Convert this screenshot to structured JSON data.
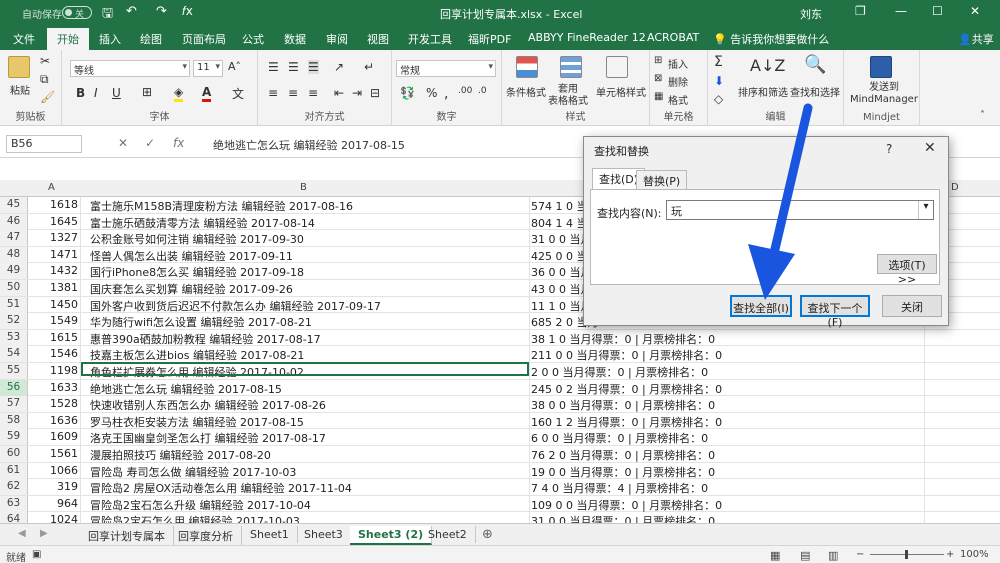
{
  "window": {
    "autosave_label": "自动保存",
    "autosave_state": "关",
    "title": "回享计划专属本.xlsx  -  Excel",
    "user": "刘东",
    "restore_glyph": "❐",
    "minimize_glyph": "—",
    "maximize_glyph": "☐",
    "close_glyph": "✕"
  },
  "qat": {
    "save": "🖫",
    "undo": "↶",
    "redo": "↷",
    "fx": "𝑓x"
  },
  "tabs": [
    "文件",
    "开始",
    "插入",
    "绘图",
    "页面布局",
    "公式",
    "数据",
    "审阅",
    "视图",
    "开发工具",
    "福昕PDF",
    "ABBYY FineReader 12",
    "ACROBAT"
  ],
  "active_tab": "开始",
  "tellme": "告诉我你想要做什么",
  "share": "共享",
  "ribbon": {
    "clipboard": {
      "paste": "粘贴",
      "label": "剪贴板"
    },
    "font": {
      "name": "等线",
      "size": "11",
      "label": "字体",
      "bold": "B",
      "italic": "I",
      "underline": "U"
    },
    "alignment": {
      "label": "对齐方式"
    },
    "number": {
      "format": "常规",
      "label": "数字"
    },
    "styles": {
      "cond": "条件格式",
      "table": "套用\n表格格式",
      "cell": "单元格样式",
      "label": "样式"
    },
    "cells": {
      "insert": "插入",
      "delete": "删除",
      "format": "格式",
      "label": "单元格"
    },
    "editing": {
      "sort": "排序和筛选",
      "find": "查找和选择",
      "label": "编辑"
    },
    "mindjet": {
      "send": "发送到\nMindManager",
      "label": "Mindjet"
    }
  },
  "formula_bar": {
    "name_box": "B56",
    "cancel": "✕",
    "enter": "✓",
    "fx": "fx",
    "content": "绝地逃亡怎么玩 编辑经验 2017-08-15"
  },
  "columns": [
    "A",
    "B",
    "D"
  ],
  "rows": [
    {
      "n": "45",
      "a": "1618",
      "b": "富士施乐M158B清理废粉方法 编辑经验 2017-08-16",
      "c": "574 1 0 当月"
    },
    {
      "n": "46",
      "a": "1645",
      "b": "富士施乐硒鼓清零方法 编辑经验 2017-08-14",
      "c": "804 1 4 当月"
    },
    {
      "n": "47",
      "a": "1327",
      "b": "公积金账号如何注销 编辑经验 2017-09-30",
      "c": "31 0 0 当月"
    },
    {
      "n": "48",
      "a": "1471",
      "b": "怪兽人偶怎么出装 编辑经验 2017-09-11",
      "c": "425 0 0 当月"
    },
    {
      "n": "49",
      "a": "1432",
      "b": "国行iPhone8怎么买 编辑经验 2017-09-18",
      "c": "36 0 0 当月"
    },
    {
      "n": "50",
      "a": "1381",
      "b": "国庆套怎么买划算 编辑经验 2017-09-26",
      "c": "43 0 0 当月"
    },
    {
      "n": "51",
      "a": "1450",
      "b": "国外客户收到货后迟迟不付款怎么办 编辑经验 2017-09-17",
      "c": "11 1 0 当月"
    },
    {
      "n": "52",
      "a": "1549",
      "b": "华为随行wifi怎么设置 编辑经验 2017-08-21",
      "c": "685 2 0 当月"
    },
    {
      "n": "53",
      "a": "1615",
      "b": "惠普390a硒鼓加粉教程 编辑经验 2017-08-17",
      "c": "38 1 0 当月得票：0 | 月票榜排名：0"
    },
    {
      "n": "54",
      "a": "1546",
      "b": "技嘉主板怎么进bios 编辑经验 2017-08-21",
      "c": "211 0 0 当月得票：0 | 月票榜排名：0"
    },
    {
      "n": "55",
      "a": "1198",
      "b": "角色栏扩展券怎么用 编辑经验 2017-10-02",
      "c": "2 0 0 当月得票：0 | 月票榜排名：0"
    },
    {
      "n": "56",
      "a": "1633",
      "b": "绝地逃亡怎么玩 编辑经验 2017-08-15",
      "c": "245 0 2 当月得票：0 | 月票榜排名：0"
    },
    {
      "n": "57",
      "a": "1528",
      "b": "快速收错别人东西怎么办 编辑经验 2017-08-26",
      "c": "38 0 0 当月得票：0 | 月票榜排名：0"
    },
    {
      "n": "58",
      "a": "1636",
      "b": "罗马柱衣柜安装方法 编辑经验 2017-08-15",
      "c": "160 1 2 当月得票：0 | 月票榜排名：0"
    },
    {
      "n": "59",
      "a": "1609",
      "b": "洛克王国幽皇剑圣怎么打 编辑经验 2017-08-17",
      "c": "6 0 0 当月得票：0 | 月票榜排名：0"
    },
    {
      "n": "60",
      "a": "1561",
      "b": "漫展拍照技巧 编辑经验 2017-08-20",
      "c": "76 2 0 当月得票：0 | 月票榜排名：0"
    },
    {
      "n": "61",
      "a": "1066",
      "b": "冒险岛 寿司怎么做 编辑经验 2017-10-03",
      "c": "19 0 0 当月得票：0 | 月票榜排名：0"
    },
    {
      "n": "62",
      "a": "319",
      "b": "冒险岛2 房屋OX活动卷怎么用 编辑经验 2017-11-04",
      "c": "7 4 0 当月得票：4 | 月票榜排名：0"
    },
    {
      "n": "63",
      "a": "964",
      "b": "冒险岛2宝石怎么升级 编辑经验 2017-10-04",
      "c": "109 0 0 当月得票：0 | 月票榜排名：0"
    },
    {
      "n": "64",
      "a": "1024",
      "b": "冒险岛2宝石怎么用 编辑经验 2017-10-03",
      "c": "31 0 0 当月得票：0 | 月票榜排名：0"
    },
    {
      "n": "65",
      "a": "1282",
      "b": "冒险岛2宝石怎样获得 编辑经验 2017-10-01",
      "c": "779 0 0 当月得票：0 | 月票榜排名：0"
    },
    {
      "n": "66",
      "a": "1252",
      "b": "冒险岛2符文剑士属性怎么加 编辑经验 2017-10-01",
      "c": "443 0 0 当月得票：0 | 月票榜排名：0"
    }
  ],
  "selected_row": "56",
  "sheet_tabs": [
    "回享计划专属本",
    "回享度分析",
    "Sheet1",
    "Sheet3",
    "Sheet3 (2)",
    "Sheet2"
  ],
  "active_sheet": "Sheet3 (2)",
  "status": {
    "ready": "就绪",
    "zoom": "100%"
  },
  "dialog": {
    "title": "查找和替换",
    "help": "?",
    "close": "✕",
    "tab_find": "查找(D)",
    "tab_replace": "替换(P)",
    "find_label": "查找内容(N):",
    "find_value": "玩",
    "options": "选项(T) >>",
    "find_all": "查找全部(I)",
    "find_next": "查找下一个(F)",
    "close_btn": "关闭"
  },
  "colors": {
    "excel_green": "#217346",
    "arrow_blue": "#1a55e0"
  }
}
